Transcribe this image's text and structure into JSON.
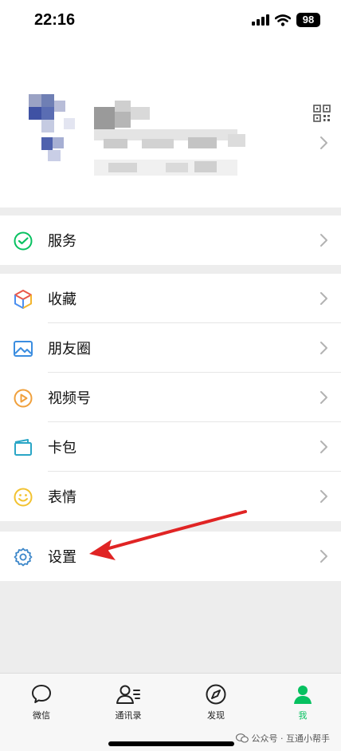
{
  "status_bar": {
    "time": "22:16",
    "battery": "98"
  },
  "menu": {
    "services": {
      "label": "服务"
    },
    "group2": [
      {
        "label": "收藏"
      },
      {
        "label": "朋友圈"
      },
      {
        "label": "视频号"
      },
      {
        "label": "卡包"
      },
      {
        "label": "表情"
      }
    ],
    "settings": {
      "label": "设置"
    }
  },
  "tabbar": {
    "tabs": [
      {
        "label": "微信"
      },
      {
        "label": "通讯录"
      },
      {
        "label": "发现"
      },
      {
        "label": "我",
        "active": true
      }
    ]
  },
  "watermark": "公众号 · 互通小帮手",
  "colors": {
    "accent": "#07c160",
    "arrow": "#e02424"
  }
}
